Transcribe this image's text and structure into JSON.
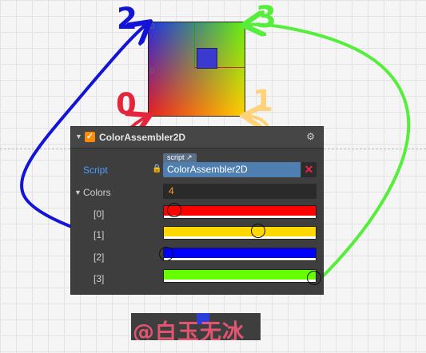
{
  "labels": {
    "zero": "0",
    "one": "1",
    "two": "2",
    "three": "3"
  },
  "colors": {
    "zero": "#e3263b",
    "one": "#ffd27a",
    "two": "#1414d8",
    "three": "#55ee3a"
  },
  "rulers": {
    "top": "0",
    "mid": "0"
  },
  "inspector": {
    "component_title": "ColorAssembler2D",
    "script_label": "Script",
    "script_tag": "script",
    "script_value": "ColorAssembler2D",
    "colors_label": "Colors",
    "colors_count": "4",
    "items": [
      {
        "label": "[0]",
        "color": "#ff0000"
      },
      {
        "label": "[1]",
        "color": "#ffd800"
      },
      {
        "label": "[2]",
        "color": "#0000ff"
      },
      {
        "label": "[3]",
        "color": "#66ff00"
      }
    ]
  },
  "watermark": {
    "text": "@白玉无冰"
  }
}
